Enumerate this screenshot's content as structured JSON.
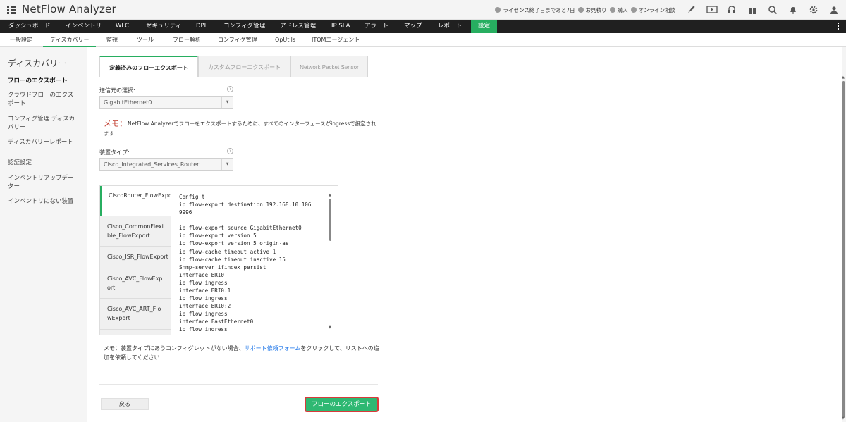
{
  "app": {
    "title": "NetFlow Analyzer"
  },
  "topbar": {
    "license_text": "ライセンス終了日まであと7日",
    "quote_text": "お見積り",
    "buy_text": "購入",
    "consult_text": "オンライン相談"
  },
  "main_nav": [
    {
      "label": "ダッシュボード"
    },
    {
      "label": "インベントリ"
    },
    {
      "label": "WLC"
    },
    {
      "label": "セキュリティ"
    },
    {
      "label": "DPI"
    },
    {
      "label": "コンフィグ管理"
    },
    {
      "label": "アドレス管理"
    },
    {
      "label": "IP SLA"
    },
    {
      "label": "アラート"
    },
    {
      "label": "マップ"
    },
    {
      "label": "レポート"
    },
    {
      "label": "設定",
      "active": true
    }
  ],
  "sub_nav": [
    {
      "label": "一般設定"
    },
    {
      "label": "ディスカバリー",
      "active": true
    },
    {
      "label": "監視"
    },
    {
      "label": "ツール"
    },
    {
      "label": "フロー解析"
    },
    {
      "label": "コンフィグ管理"
    },
    {
      "label": "OpUtils"
    },
    {
      "label": "ITOMエージェント"
    }
  ],
  "sidebar": {
    "title": "ディスカバリー",
    "items": [
      {
        "label": "フローのエクスポート",
        "active": true
      },
      {
        "label": "クラウドフローのエクスポート"
      },
      {
        "label": "コンフィグ管理 ディスカバリー"
      },
      {
        "label": "ディスカバリーレポート"
      },
      {
        "label": "認証設定"
      },
      {
        "label": "インベントリアップデーター"
      },
      {
        "label": "インベントリにない装置"
      }
    ]
  },
  "tabs": [
    {
      "label": "定義済みのフローエクスポート",
      "active": true
    },
    {
      "label": "カスタムフローエクスポート"
    },
    {
      "label": "Network Packet Sensor"
    }
  ],
  "form": {
    "source_label": "送信元の選択:",
    "source_value": "GigabitEthernet0",
    "memo_key": "メモ：",
    "memo_text": "NetFlow Analyzerでフローをエクスポートするために、すべてのインターフェースがingressで設定されます",
    "device_type_label": "装置タイプ:",
    "device_type_value": "Cisco_Integrated_Services_Router",
    "help_glyph": "?"
  },
  "config_templates": [
    {
      "label": "CiscoRouter_FlowExport",
      "active": true
    },
    {
      "label": "Cisco_CommonFlexible_FlowExport"
    },
    {
      "label": "Cisco_ISR_FlowExport"
    },
    {
      "label": "Cisco_AVC_FlowExport"
    },
    {
      "label": "Cisco_AVC_ART_FlowExport"
    }
  ],
  "config_code": "Config t\nip flow-export destination 192.168.10.106\n9996\n\nip flow-export source GigabitEthernet0\nip flow-export version 5\nip flow-export version 5 origin-as\nip flow-cache timeout active 1\nip flow-cache timeout inactive 15\nSnmp-server ifindex persist\ninterface BRI0\nip flow ingress\ninterface BRI0:1\nip flow ingress\ninterface BRI0:2\nip flow ingress\ninterface FastEthernet0\nip flow ingress",
  "note": {
    "prefix": "メモ：装置タイプにあうコンフィグレットがない場合、",
    "link": "サポート依頼フォーム",
    "suffix": "をクリックして、リストへの追加を依頼してください"
  },
  "buttons": {
    "back": "戻る",
    "export": "フローのエクスポート"
  },
  "colors": {
    "accent": "#27ae60",
    "highlight": "#d93a3a",
    "navbar": "#202020",
    "link": "#1a73e8"
  }
}
